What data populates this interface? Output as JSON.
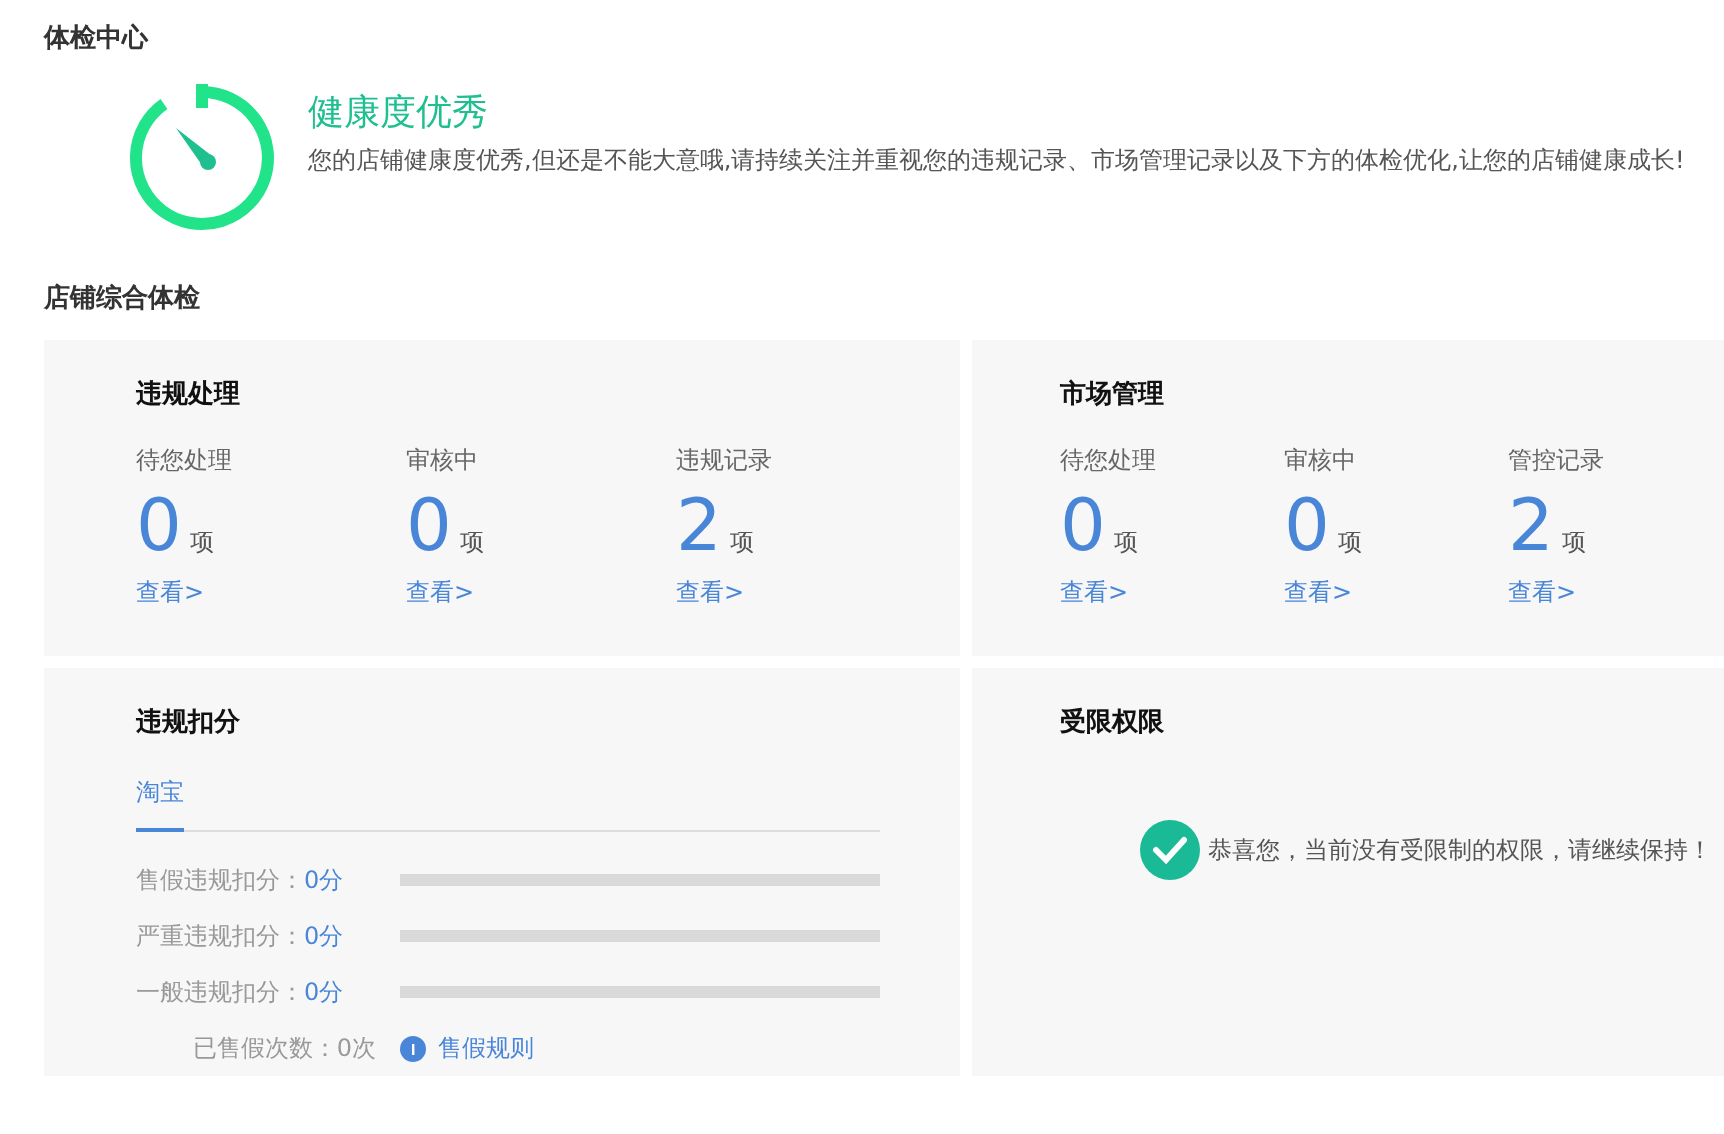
{
  "health_center": {
    "title": "体检中心",
    "status": "健康度优秀",
    "description": "您的店铺健康度优秀,但还是不能大意哦,请持续关注并重视您的违规记录、市场管理记录以及下方的体检优化,让您的店铺健康成长!"
  },
  "overview": {
    "title": "店铺综合体检",
    "violation_handling": {
      "title": "违规处理",
      "stats": [
        {
          "label": "待您处理",
          "value": "0",
          "unit": "项",
          "link": "查看>"
        },
        {
          "label": "审核中",
          "value": "0",
          "unit": "项",
          "link": "查看>"
        },
        {
          "label": "违规记录",
          "value": "2",
          "unit": "项",
          "link": "查看>"
        }
      ]
    },
    "market_management": {
      "title": "市场管理",
      "stats": [
        {
          "label": "待您处理",
          "value": "0",
          "unit": "项",
          "link": "查看>"
        },
        {
          "label": "审核中",
          "value": "0",
          "unit": "项",
          "link": "查看>"
        },
        {
          "label": "管控记录",
          "value": "2",
          "unit": "项",
          "link": "查看>"
        }
      ]
    },
    "deductions": {
      "title": "违规扣分",
      "tabs": [
        {
          "label": "淘宝",
          "selected": true
        }
      ],
      "rows": [
        {
          "label": "售假违规扣分：",
          "score": "0分",
          "level": 0
        },
        {
          "label": "严重违规扣分：",
          "score": "0分",
          "level": 0
        },
        {
          "label": "一般违规扣分：",
          "score": "0分",
          "level": 0
        }
      ],
      "count": "已售假次数：0次",
      "rules_link": "售假规则"
    },
    "restrictions": {
      "title": "受限权限",
      "message": "恭喜您，当前没有受限制的权限，请继续保持！"
    }
  }
}
